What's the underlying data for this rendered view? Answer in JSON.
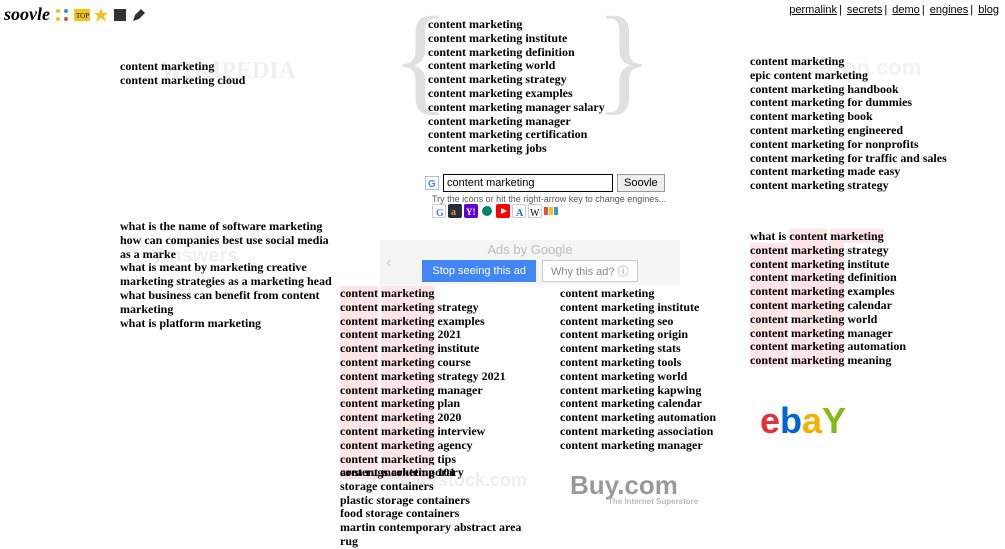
{
  "logo": "soovle",
  "nav": {
    "permalink": "permalink",
    "secrets": "secrets",
    "demo": "demo",
    "engines": "engines",
    "blog": "blog"
  },
  "search": {
    "value": "content marketing",
    "button": "Soovle",
    "hint": "Try the icons or hit the right-arrow key to change engines..."
  },
  "engines": [
    "google",
    "bing",
    "yahoo",
    "youtube",
    "amazon",
    "wikipedia",
    "overstock"
  ],
  "ad": {
    "title": "Ads by Google",
    "stop": "Stop seeing this ad",
    "why": "Why this ad?"
  },
  "wm": {
    "wiki": "WIKIPEDIA",
    "answers": "Answers",
    "overstock": "overstock.com",
    "buy": "Buy.com",
    "buysub": "The Internet Superstore",
    "amazon": "amazon.com"
  },
  "cols": {
    "wiki": [
      "content marketing",
      "content marketing cloud"
    ],
    "answers": [
      "what is the name of software marketing",
      "how can companies best use social media as a marke",
      "what is meant by marketing creative",
      "marketing strategies as a marketing head",
      "what business can benefit from content marketing",
      "what is platform marketing"
    ],
    "google": [
      "content marketing",
      "content marketing institute",
      "content marketing definition",
      "content marketing world",
      "content marketing strategy",
      "content marketing examples",
      "content marketing manager salary",
      "content marketing manager",
      "content marketing certification",
      "content marketing jobs"
    ],
    "yahoo": [
      "content marketing",
      "content marketing strategy",
      "content marketing examples",
      "content marketing 2021",
      "content marketing institute",
      "content marketing course",
      "content marketing strategy 2021",
      "content marketing manager",
      "content marketing plan",
      "content marketing 2020",
      "content marketing interview",
      "content marketing agency",
      "content marketing tips",
      "content marketing 101"
    ],
    "bing": [
      "content marketing",
      "content marketing institute",
      "content marketing seo",
      "content marketing origin",
      "content marketing stats",
      "content marketing tools",
      "content marketing world",
      "content marketing kapwing",
      "content marketing calendar",
      "content marketing automation",
      "content marketing association",
      "content marketing manager"
    ],
    "overstock": [
      "area rugs contemporary",
      "storage containers",
      "plastic storage containers",
      "food storage containers",
      "martin contemporary abstract area rug"
    ],
    "amazon": [
      "content marketing",
      "epic content marketing",
      "content marketing handbook",
      "content marketing for dummies",
      "content marketing book",
      "content marketing engineered",
      "content marketing for nonprofits",
      "content marketing for traffic and sales",
      "content marketing made easy",
      "content marketing strategy"
    ],
    "ebay": [
      "what is content marketing",
      "content marketing strategy",
      "content marketing institute",
      "content marketing definition",
      "content marketing examples",
      "content marketing calendar",
      "content marketing world",
      "content marketing manager",
      "content marketing automation",
      "content marketing meaning"
    ]
  }
}
